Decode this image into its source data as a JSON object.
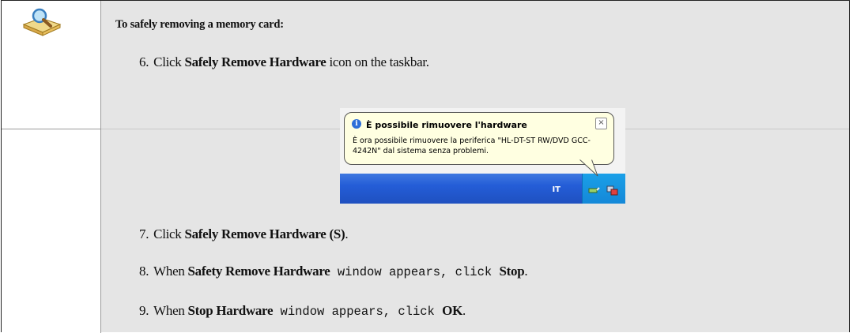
{
  "heading": "To safely removing a memory card:",
  "steps": [
    {
      "num": "6.",
      "pre": "Click ",
      "bold": "Safely Remove Hardware",
      "post": " icon on the taskbar."
    },
    {
      "num": "7.",
      "pre": "Click ",
      "bold": "Safely Remove Hardware (S)",
      "post": "."
    },
    {
      "num": "8.",
      "pre": "When ",
      "bold": "Safety Remove Hardware",
      "mid": " window appears, click ",
      "bold2": "Stop",
      "post": "."
    },
    {
      "num": "9.",
      "pre": "When ",
      "bold": "Stop Hardware",
      "mid": " window appears, click ",
      "bold2": "OK",
      "post": "."
    }
  ],
  "screenshot": {
    "balloon_title": "È possibile rimuovere l'hardware",
    "balloon_text": "È ora possibile rimuovere la periferica \"HL-DT-ST RW/DVD GCC-4242N\" dal sistema senza problemi.",
    "close_glyph": "×",
    "info_glyph": "i",
    "language": "IT"
  },
  "icons": {
    "note": "magnifier-book-icon"
  },
  "colors": {
    "content_bg": "#e5e5e5",
    "balloon_bg": "#ffffe1",
    "taskbar": "#245dd7"
  }
}
